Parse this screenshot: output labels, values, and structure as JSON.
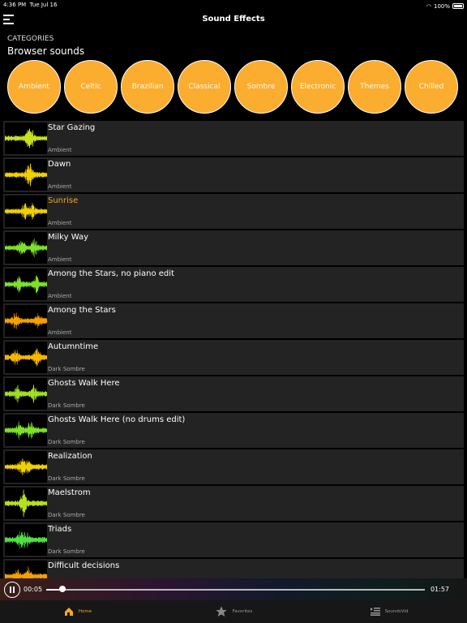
{
  "status": {
    "time": "4:36 PM",
    "date": "Tue Jul 16",
    "battery": "100%",
    "battery_level": 1.0
  },
  "nav": {
    "title": "Sound Effects"
  },
  "categories": {
    "heading": "CATEGORIES",
    "subheading": "Browser sounds",
    "items": [
      "Ambient",
      "Celtic",
      "Brazilian",
      "Classical",
      "Sombre",
      "Electronic",
      "Themes",
      "Chilled"
    ],
    "color": "#fbad30"
  },
  "tracks": [
    {
      "title": "Star Gazing",
      "category": "Ambient",
      "wave_color": "#c8e020"
    },
    {
      "title": "Dawn",
      "category": "Ambient",
      "wave_color": "#f0d000"
    },
    {
      "title": "Sunrise",
      "category": "Ambient",
      "wave_color": "#f0d000",
      "active": true
    },
    {
      "title": "Milky Way",
      "category": "Ambient",
      "wave_color": "#7ee02a"
    },
    {
      "title": "Among the Stars, no piano edit",
      "category": "Ambient",
      "wave_color": "#7ee02a"
    },
    {
      "title": "Among the Stars",
      "category": "Ambient",
      "wave_color": "#f5a000"
    },
    {
      "title": "Autumntime",
      "category": "Dark Sombre",
      "wave_color": "#f5b800"
    },
    {
      "title": "Ghosts Walk Here",
      "category": "Dark Sombre",
      "wave_color": "#9ee020"
    },
    {
      "title": "Ghosts Walk Here (no drums edit)",
      "category": "Dark Sombre",
      "wave_color": "#7ee02a"
    },
    {
      "title": "Realization",
      "category": "Dark Sombre",
      "wave_color": "#f0d000"
    },
    {
      "title": "Maelstrom",
      "category": "Dark Sombre",
      "wave_color": "#b8e020"
    },
    {
      "title": "Triads",
      "category": "Dark Sombre",
      "wave_color": "#50e040"
    },
    {
      "title": "Difficult decisions",
      "category": "",
      "wave_color": "#f5a000"
    }
  ],
  "player": {
    "elapsed": "00:05",
    "duration": "01:57",
    "progress": 0.043
  },
  "tabs": [
    {
      "label": "Home",
      "icon": "home-icon",
      "active": true
    },
    {
      "label": "Favorites",
      "icon": "star-icon"
    },
    {
      "label": "SoundsVid",
      "icon": "video-list-icon"
    }
  ],
  "accent": "#f5a623"
}
